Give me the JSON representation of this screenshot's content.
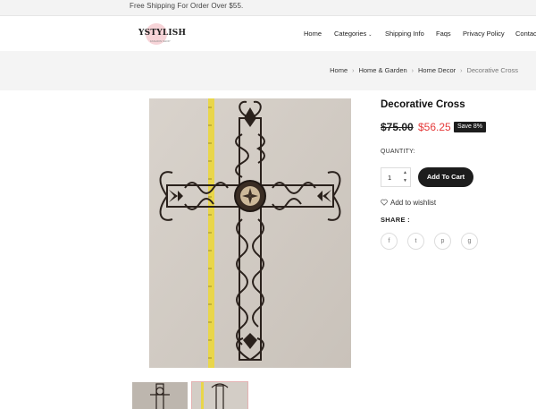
{
  "topbar": {
    "text": "Free Shipping For Order Over $55."
  },
  "header": {
    "logo": "YSTYLISH",
    "logo_tagline": "FASHION SHOP",
    "nav": [
      {
        "label": "Home"
      },
      {
        "label": "Categories"
      },
      {
        "label": "Shipping Info"
      },
      {
        "label": "Faqs"
      },
      {
        "label": "Privacy Policy"
      },
      {
        "label": "Contac"
      }
    ]
  },
  "breadcrumb": [
    {
      "label": "Home"
    },
    {
      "label": "Home & Garden"
    },
    {
      "label": "Home Decor"
    },
    {
      "label": "Decorative Cross"
    }
  ],
  "product": {
    "title": "Decorative Cross",
    "old_price": "$75.00",
    "new_price": "$56.25",
    "badge": "Save 8%",
    "quantity_label": "QUANTITY:",
    "quantity": "1",
    "add_to_cart": "Add To Cart",
    "wishlist": "Add to wishlist",
    "share_label": "SHARE :",
    "social": [
      {
        "icon": "facebook-icon",
        "glyph": "f"
      },
      {
        "icon": "twitter-icon",
        "glyph": "t"
      },
      {
        "icon": "pinterest-icon",
        "glyph": "p"
      },
      {
        "icon": "google-plus-icon",
        "glyph": "g"
      }
    ]
  },
  "colors": {
    "accent_price": "#e53a3a",
    "dark": "#1d1d1d",
    "wall": "#d3cdc6"
  }
}
